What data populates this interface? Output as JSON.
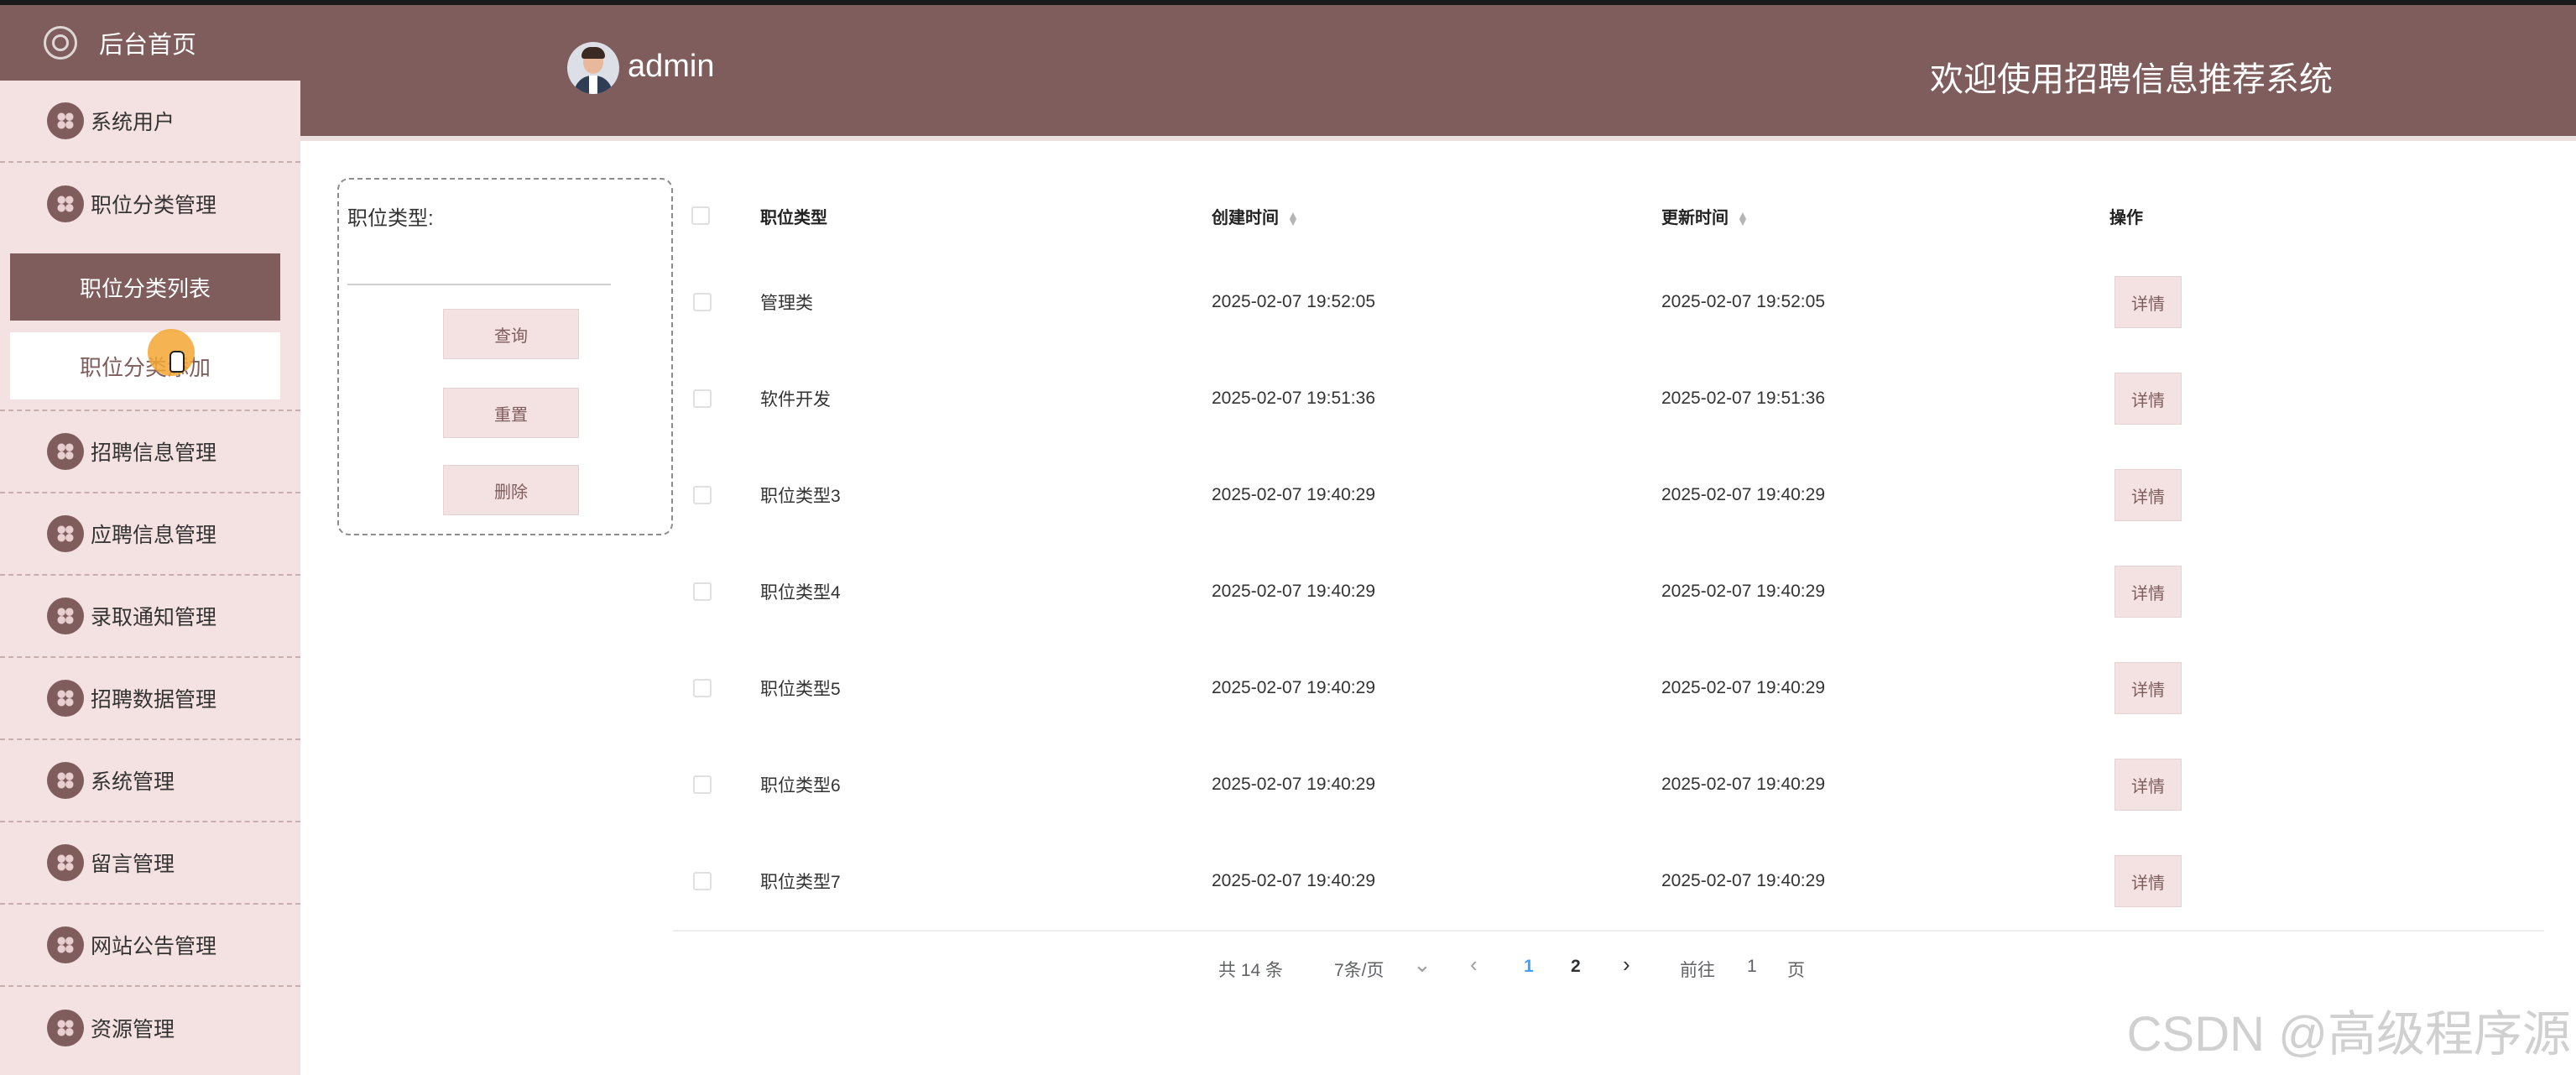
{
  "sidebar": {
    "home_label": "后台首页",
    "items": [
      {
        "label": "系统用户"
      },
      {
        "label": "职位分类管理"
      },
      {
        "label": "招聘信息管理"
      },
      {
        "label": "应聘信息管理"
      },
      {
        "label": "录取通知管理"
      },
      {
        "label": "招聘数据管理"
      },
      {
        "label": "系统管理"
      },
      {
        "label": "留言管理"
      },
      {
        "label": "网站公告管理"
      },
      {
        "label": "资源管理"
      }
    ],
    "submenu": {
      "active": "职位分类列表",
      "second": "职位分类添加"
    }
  },
  "header": {
    "username": "admin",
    "welcome": "欢迎使用招聘信息推荐系统"
  },
  "search": {
    "label": "职位类型:",
    "query_button": "查询",
    "reset_button": "重置",
    "delete_button": "删除"
  },
  "table": {
    "columns": [
      "职位类型",
      "创建时间",
      "更新时间",
      "操作"
    ],
    "detail_label": "详情",
    "rows": [
      {
        "type": "管理类",
        "created": "2025-02-07 19:52:05",
        "updated": "2025-02-07 19:52:05"
      },
      {
        "type": "软件开发",
        "created": "2025-02-07 19:51:36",
        "updated": "2025-02-07 19:51:36"
      },
      {
        "type": "职位类型3",
        "created": "2025-02-07 19:40:29",
        "updated": "2025-02-07 19:40:29"
      },
      {
        "type": "职位类型4",
        "created": "2025-02-07 19:40:29",
        "updated": "2025-02-07 19:40:29"
      },
      {
        "type": "职位类型5",
        "created": "2025-02-07 19:40:29",
        "updated": "2025-02-07 19:40:29"
      },
      {
        "type": "职位类型6",
        "created": "2025-02-07 19:40:29",
        "updated": "2025-02-07 19:40:29"
      },
      {
        "type": "职位类型7",
        "created": "2025-02-07 19:40:29",
        "updated": "2025-02-07 19:40:29"
      }
    ]
  },
  "pagination": {
    "total": "共 14 条",
    "page_size": "7条/页",
    "page_1": "1",
    "page_2": "2",
    "goto_label": "前往",
    "goto_value": "1",
    "goto_suffix": "页"
  },
  "watermark": "CSDN @高级程序源"
}
